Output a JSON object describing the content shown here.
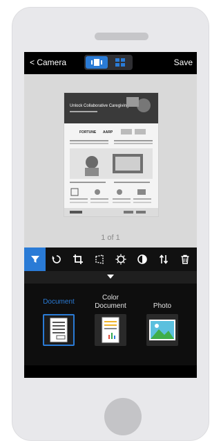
{
  "header": {
    "back_label": "< Camera",
    "save_label": "Save"
  },
  "preview": {
    "page_indicator": "1 of 1"
  },
  "doc": {
    "title": "Unlock Collaborative Caregiving",
    "logos": [
      "FORTUNE",
      "AARP"
    ]
  },
  "toolbar": {
    "tools": [
      {
        "name": "filter-icon",
        "active": true
      },
      {
        "name": "rotate-icon",
        "active": false
      },
      {
        "name": "crop-icon",
        "active": false
      },
      {
        "name": "perspective-icon",
        "active": false
      },
      {
        "name": "brightness-icon",
        "active": false
      },
      {
        "name": "contrast-icon",
        "active": false
      },
      {
        "name": "sort-icon",
        "active": false
      },
      {
        "name": "trash-icon",
        "active": false
      }
    ]
  },
  "modes": [
    {
      "label": "Document",
      "selected": true
    },
    {
      "label": "Color\nDocument",
      "selected": false
    },
    {
      "label": "Photo",
      "selected": false
    }
  ],
  "colors": {
    "accent": "#2a7bd6",
    "bar": "#000000",
    "chart_red": "#e04b3a",
    "chart_green": "#2fa84f",
    "chart_blue": "#2a7bd6",
    "photo_sky": "#5bc0de",
    "photo_ground": "#3fae49"
  }
}
